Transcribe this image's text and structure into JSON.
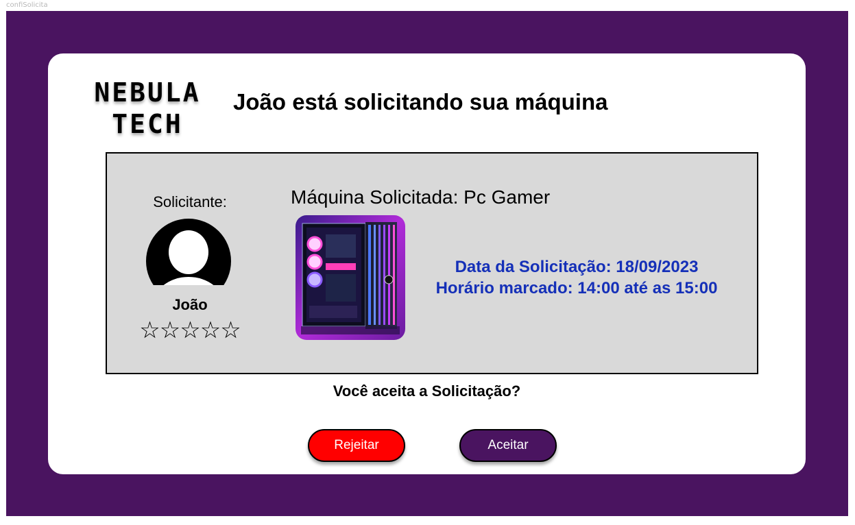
{
  "frame": {
    "label": "confiSolicita"
  },
  "logo": {
    "line1": "NEBULA",
    "line2": "TECH"
  },
  "header": {
    "title": "João está solicitando sua máquina"
  },
  "requester": {
    "label": "Solicitante:",
    "name": "João",
    "avatar_icon": "user-avatar-icon",
    "rating_max": 5,
    "rating_value": 0,
    "stars": "☆☆☆☆☆"
  },
  "machine": {
    "title": "Máquina Solicitada: Pc Gamer",
    "image_icon": "gaming-pc-image"
  },
  "schedule": {
    "date_text": "Data da Solicitação: 18/09/2023",
    "time_text": "Horário marcado: 14:00 até as 15:00"
  },
  "prompt": {
    "question": "Você aceita a Solicitação?"
  },
  "actions": {
    "reject_label": "Rejeitar",
    "accept_label": "Aceitar"
  },
  "colors": {
    "frame_bg": "#4a1460",
    "card_bg": "#ffffff",
    "panel_bg": "#d9d9d9",
    "info_text": "#1530b8",
    "reject_bg": "#ff0000",
    "accept_bg": "#4a1460"
  }
}
